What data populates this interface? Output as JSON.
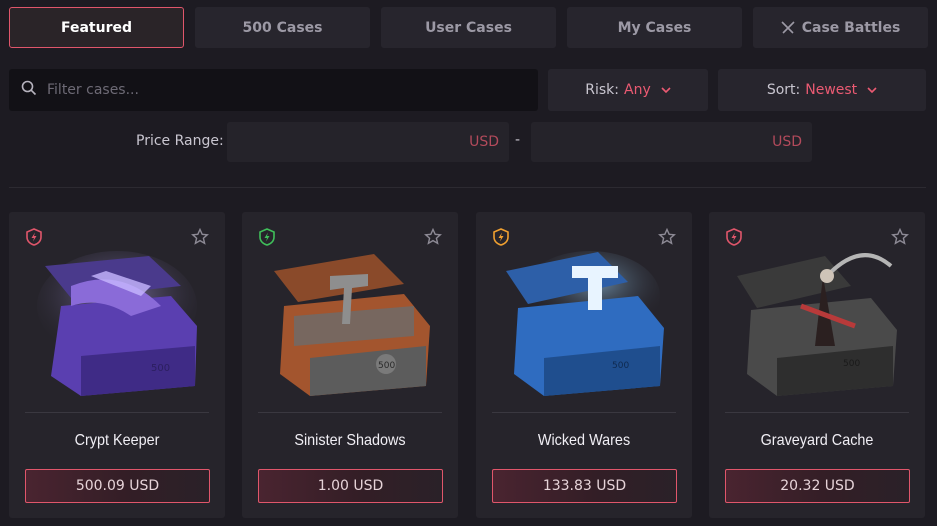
{
  "tabs": [
    {
      "label": "Featured",
      "active": true
    },
    {
      "label": "500 Cases",
      "active": false
    },
    {
      "label": "User Cases",
      "active": false
    },
    {
      "label": "My Cases",
      "active": false
    },
    {
      "label": "Case Battles",
      "active": false,
      "icon": "crossed-swords-icon"
    }
  ],
  "search": {
    "placeholder": "Filter cases..."
  },
  "risk": {
    "label": "Risk:",
    "value": "Any"
  },
  "sort": {
    "label": "Sort:",
    "value": "Newest"
  },
  "price_range": {
    "label": "Price Range:",
    "separator": "-",
    "min_unit": "USD",
    "max_unit": "USD"
  },
  "colors": {
    "accent": "#e0566b",
    "risk_red": "#e0566b",
    "risk_green": "#3fbf5a",
    "risk_orange": "#f0a030"
  },
  "cases": [
    {
      "name": "Crypt Keeper",
      "price": "500.09 USD",
      "risk": "high",
      "risk_color": "#e0566b"
    },
    {
      "name": "Sinister Shadows",
      "price": "1.00 USD",
      "risk": "low",
      "risk_color": "#3fbf5a"
    },
    {
      "name": "Wicked Wares",
      "price": "133.83 USD",
      "risk": "medium",
      "risk_color": "#f0a030"
    },
    {
      "name": "Graveyard Cache",
      "price": "20.32 USD",
      "risk": "high",
      "risk_color": "#e0566b"
    }
  ]
}
